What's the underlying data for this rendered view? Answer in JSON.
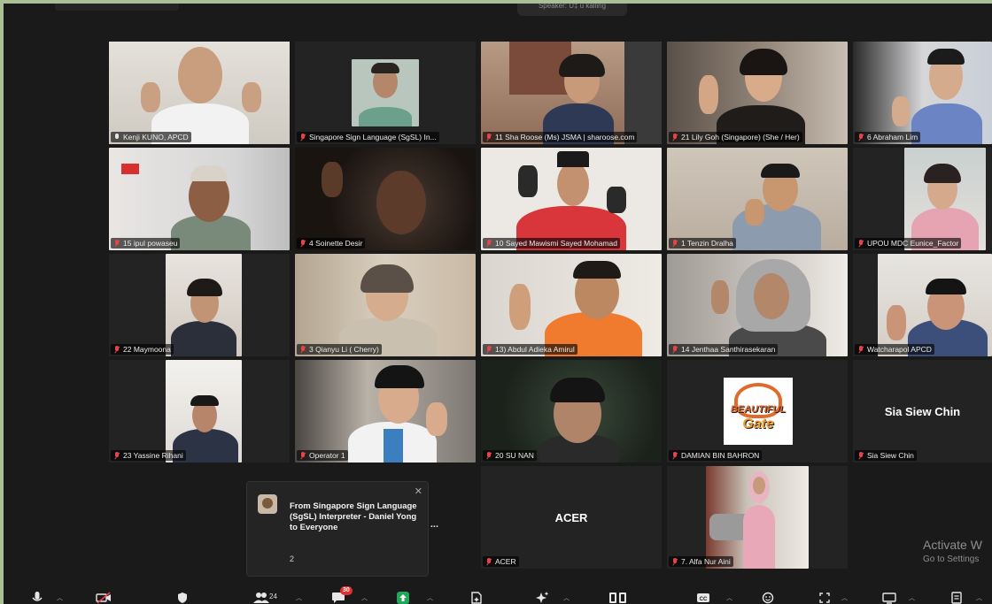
{
  "window": {
    "speaker_indicator": "Speaker: Ù‡ ü kalling"
  },
  "participants": [
    {
      "name": "Kenji KUNO, APCD",
      "mic": "on"
    },
    {
      "name": "Singapore Sign Language (SgSL) In...",
      "mic": "muted-hand"
    },
    {
      "name": "11 Sha Roose (Ms) JSMA | sharoose.com",
      "mic": "muted"
    },
    {
      "name": "21 Lily Goh (Singapore) (She / Her)",
      "mic": "muted"
    },
    {
      "name": "6 Abraham Lim",
      "mic": "muted"
    },
    {
      "name": "15 ipul powaseu",
      "mic": "muted"
    },
    {
      "name": "4 Soinette Desir",
      "mic": "muted"
    },
    {
      "name": "10 Sayed Mawismi Sayed Mohamad",
      "mic": "muted"
    },
    {
      "name": "1 Tenzin Dralha",
      "mic": "muted"
    },
    {
      "name": "UPOU MDC Eunice_Factor",
      "mic": "muted"
    },
    {
      "name": "22 Maymoona",
      "mic": "muted"
    },
    {
      "name": "3 Qianyu Li ( Cherry)",
      "mic": "muted"
    },
    {
      "name": "13) Abdul Adieka Amirul",
      "mic": "muted"
    },
    {
      "name": "14 Jenthaa Santhirasekaran",
      "mic": "muted"
    },
    {
      "name": "Watcharapol APCD",
      "mic": "muted"
    },
    {
      "name": "23 Yassine Rihani",
      "mic": "muted"
    },
    {
      "name": "Operator 1",
      "mic": "muted"
    },
    {
      "name": "20 SU NAN",
      "mic": "muted"
    },
    {
      "name": "DAMIAN BIN BAHRON",
      "mic": "muted"
    },
    {
      "name": "Sia Siew Chin",
      "mic": "muted",
      "center_text": "Sia Siew Chin"
    },
    {
      "name": "ACER",
      "mic": "muted",
      "center_text": "ACER"
    },
    {
      "name": "7. Alfa Nur Aini",
      "mic": "muted"
    }
  ],
  "logo": {
    "line1": "BEAUTIFUL",
    "line2": "Gate"
  },
  "chat_toast": {
    "sender": "From Singapore Sign Language (SgSL) Interpreter - Daniel Yong to Everyone",
    "message": "2",
    "close_icon": "close-icon"
  },
  "watermark": {
    "title": "Activate W",
    "subtitle": "Go to Settings"
  },
  "toolbar": {
    "participants_count": "24",
    "chat_badge": "30",
    "items": [
      "mic-icon",
      "video-off-icon",
      "security-icon",
      "participants-icon",
      "chat-icon",
      "share-icon",
      "summary-icon",
      "ai-companion-icon",
      "apps-icon",
      "captions-icon",
      "reactions-icon",
      "more-icon",
      "view-icon",
      "notes-icon"
    ]
  },
  "colors": {
    "frame": "#a9bf96",
    "background": "#1a1a1a",
    "tile": "#232323",
    "muted_red": "#e8434a",
    "share_green": "#23a55a",
    "badge_red": "#e0312e"
  }
}
